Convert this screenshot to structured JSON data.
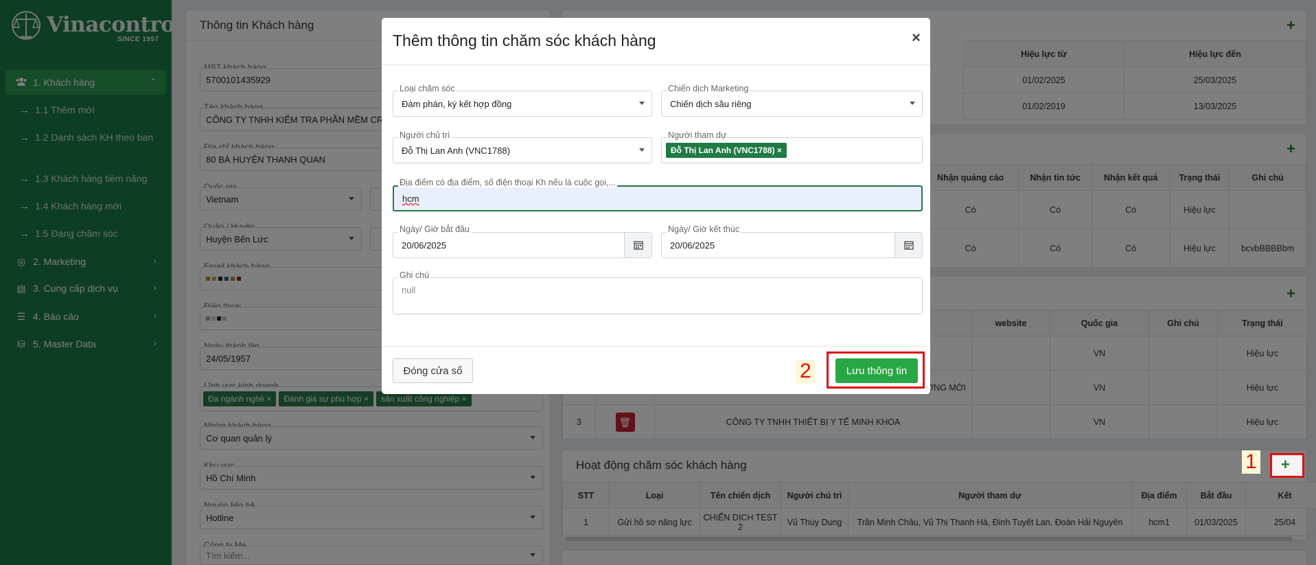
{
  "brand": {
    "name": "Vinacontrol",
    "since": "SINCE 1957"
  },
  "sidebar": {
    "items": [
      {
        "label": "1. Khách hàng"
      },
      {
        "label": "2. Marketing"
      },
      {
        "label": "3. Cung cấp dịch vụ"
      },
      {
        "label": "4. Báo cáo"
      },
      {
        "label": "5. Master Data"
      }
    ],
    "subitems": [
      {
        "label": "1.1 Thêm mới"
      },
      {
        "label": "1.2 Danh sách KH theo ban"
      },
      {
        "label": "1.3 Khách hàng tiềm năng"
      },
      {
        "label": "1.4 Khách hàng mới"
      },
      {
        "label": "1.5 Đang chăm sóc"
      }
    ]
  },
  "customer": {
    "title": "Thông tin Khách hàng",
    "fields": [
      {
        "label": "MST khách hàng",
        "value": "5700101435929"
      },
      {
        "label": "Tên khách hàng",
        "value": "CÔNG TY TNHH KIỂM TRA PHẦN MỀM CRM"
      },
      {
        "label": "Địa chỉ khách hàng",
        "value": "80 BÀ HUYỆN THANH QUAN"
      },
      {
        "label": "Quốc gia",
        "value": "Vietnam"
      },
      {
        "label": "Quận / Huyện",
        "value": "Huyện Bến Lức"
      },
      {
        "label": "Email khách hàng",
        "value": ""
      },
      {
        "label": "Điện thoại",
        "value": ""
      },
      {
        "label": "Ngày thành lập",
        "value": "24/05/1957"
      },
      {
        "label": "Lĩnh vực kinh doanh",
        "value": ""
      },
      {
        "label": "Nhóm khách hàng",
        "value": "Cơ quan quản lý"
      },
      {
        "label": "Khu vực",
        "value": "Hồ Chí Minh"
      },
      {
        "label": "Nguồn liên hệ",
        "value": "Hotline"
      },
      {
        "label": "Công ty Mẹ",
        "value": "Tìm kiếm..."
      }
    ],
    "business_tags": [
      "Đa ngành nghề",
      "Đánh giá sự phù hợp",
      "sản xuất công nghiệp"
    ],
    "tag_remove": "×"
  },
  "contracts": {
    "headers": [
      "Hiệu lực từ",
      "Hiệu lực đến"
    ],
    "rows": [
      [
        "01/02/2025",
        "25/03/2025"
      ],
      [
        "01/02/2019",
        "13/03/2025"
      ]
    ]
  },
  "subscriptions": {
    "headers": [
      "Nhận quảng cáo",
      "Nhận tin tức",
      "Nhận kết quả",
      "Trạng thái",
      "Ghi chú"
    ],
    "rows": [
      [
        "Có",
        "Có",
        "Có",
        "Hiệu lực",
        ""
      ],
      [
        "Có",
        "Có",
        "Có",
        "Hiệu lực",
        "bcvbBBBBbm"
      ]
    ]
  },
  "related": {
    "headers": [
      "website",
      "Quốc gia",
      "Ghi chú",
      "Trạng thái"
    ],
    "rows": [
      {
        "stt": "",
        "name": "",
        "website": "",
        "country": "VN",
        "note": "",
        "status": "Hiệu lực"
      },
      {
        "stt": "",
        "name": "ỜNG MỚI",
        "website": "",
        "country": "VN",
        "note": "",
        "status": "Hiệu lực"
      },
      {
        "stt": "3",
        "name": "CÔNG TY TNHH THIẾT BỊ Y TẾ MINH KHOA",
        "website": "",
        "country": "VN",
        "note": "",
        "status": "Hiệu lực"
      }
    ]
  },
  "care": {
    "title": "Hoạt động chăm sóc khách hàng",
    "headers": [
      "STT",
      "Loại",
      "Tên chiến dịch",
      "Người chủ trì",
      "Người tham dự",
      "Địa điểm",
      "Bắt đầu",
      "Kết"
    ],
    "rows": [
      [
        "1",
        "Gửi hồ sơ năng lực",
        "CHIẾN DỊCH TEST 2",
        "Vũ Thúy Dung",
        "Trần Minh Châu, Vũ Thị Thanh Hà, Đinh Tuyết Lan, Đoàn Hải Nguyên",
        "hcm1",
        "01/03/2025",
        "25/04"
      ]
    ],
    "plus": "+"
  },
  "markers": {
    "step1": "1",
    "step2": "2"
  },
  "modal": {
    "title": "Thêm thông tin chăm sóc khách hàng",
    "close": "×",
    "care_type": {
      "label": "Loại chăm sóc",
      "value": "Đàm phán, ký kết hợp đồng"
    },
    "campaign": {
      "label": "Chiến dịch Marketing",
      "value": "Chiến dịch sầu riêng"
    },
    "host": {
      "label": "Người chủ trì",
      "value": "Đỗ Thị Lan Anh (VNC1788)"
    },
    "attendees": {
      "label": "Người tham dự",
      "tags": [
        "Đỗ Thị Lan Anh (VNC1788)"
      ]
    },
    "location": {
      "label": "Địa điểm có địa điểm, số điện thoại Kh nếu là cuộc gọi,...",
      "value": "hcm"
    },
    "start": {
      "label": "Ngày/ Giờ bắt đầu",
      "value": "20/06/2025"
    },
    "end": {
      "label": "Ngày/ Giờ kết thúc",
      "value": "20/06/2025"
    },
    "note": {
      "label": "Ghi chú",
      "placeholder": "null"
    },
    "close_button": "Đóng cửa sổ",
    "save_button": "Lưu thông tin"
  },
  "colors": {
    "sidebar": "#1a7a45",
    "accent": "#28a745",
    "danger": "#c82333",
    "highlight": "#e01010"
  }
}
